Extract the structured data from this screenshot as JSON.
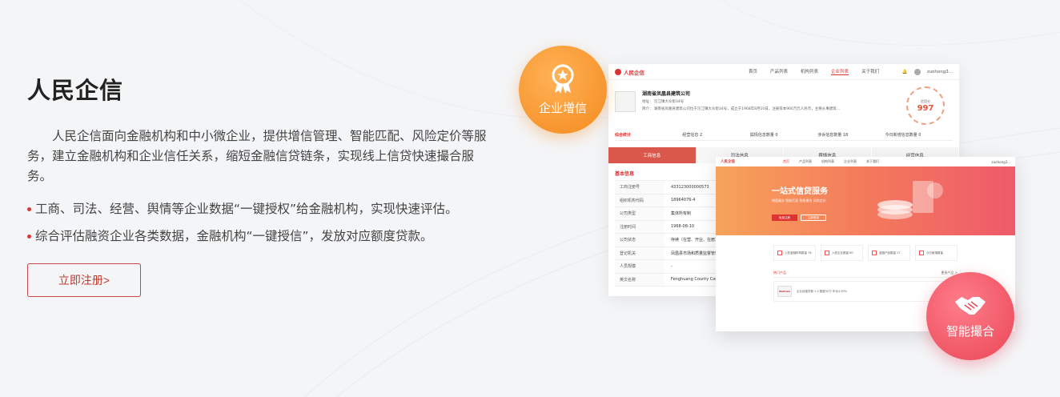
{
  "section": {
    "title": "人民企信",
    "description": "人民企信面向金融机构和中小微企业，提供增信管理、智能匹配、风险定价等服务，建立金融机构和企业信任关系，缩短金融信贷链条，实现线上信贷快速撮合服务。",
    "bullets": [
      "工商、司法、经营、舆情等企业数据“一键授权”给金融机构，实现快速评估。",
      "综合评估融资企业各类数据，金融机构“一键授信”，发放对应额度贷款。"
    ],
    "cta_label": "立即注册>"
  },
  "badges": {
    "credit": {
      "label": "企业增信",
      "icon": "award-medal-icon",
      "color": "#f48a1e"
    },
    "match": {
      "label": "智能撮合",
      "icon": "handshake-icon",
      "color": "#ea4656"
    }
  },
  "screen1": {
    "logo": "人民企信",
    "nav": [
      "首页",
      "产品列表",
      "机构列表",
      "企业列表",
      "关于我们"
    ],
    "active_nav": "企业列表",
    "user": "zuohong3...",
    "company_name": "湖南省凤凰县建筑公司",
    "company_address": "地址： 沱江镇大众街34号",
    "company_intro": "简介： 湖南省凤凰县建筑公司位于沱江镇大众街34号，成立于1968年8月10日，注册资本900万元人民币，主要从事建筑…",
    "score_label": "信用分",
    "score": "997",
    "stats_title": "综合统计",
    "stats": [
      "经营信息 2",
      "舆情信息数量 0",
      "涉诉信息数量 18",
      "今日新增信息数量 0"
    ],
    "tabs": [
      "工商信息",
      "司法信息",
      "舆情信息",
      "经营信息"
    ],
    "section": "基本信息",
    "rows": [
      {
        "k": "工商注册号",
        "v": "433123000000573"
      },
      {
        "k": "组织机构代码",
        "v": "18964076-4"
      },
      {
        "k": "公司类型",
        "v": "集体所有制"
      },
      {
        "k": "注册时间",
        "v": "1968-08-10"
      },
      {
        "k": "公司状态",
        "v": "存续（在营、开业、在册）"
      },
      {
        "k": "登记机关",
        "v": "凤凰县市场和质量监督管理局"
      },
      {
        "k": "人员规模",
        "v": "-"
      },
      {
        "k": "英文名称",
        "v": "Fenghuang County Cons..."
      }
    ]
  },
  "screen2": {
    "logo": "人民企信",
    "nav": [
      "首页",
      "产品列表",
      "机构列表",
      "企业列表",
      "关于我们"
    ],
    "user": "zuohong3...",
    "hero_title": "一站式信贷服务",
    "hero_subtitle": "增值服务  智能匹配  智能撮合  风险定价",
    "hero_btn1": "免费注册",
    "hero_btn2": "立即登录",
    "cards": [
      "入驻金融机构数量 76",
      "入驻企业数量 60",
      "金融产品数量 17",
      "今日新增数量"
    ],
    "section_title": "热门产品",
    "section_more": "更多产品 >",
    "product_logo": "Meituan",
    "product_text": "企业经营贷款 1.0  额度50万 年化4.90%"
  }
}
